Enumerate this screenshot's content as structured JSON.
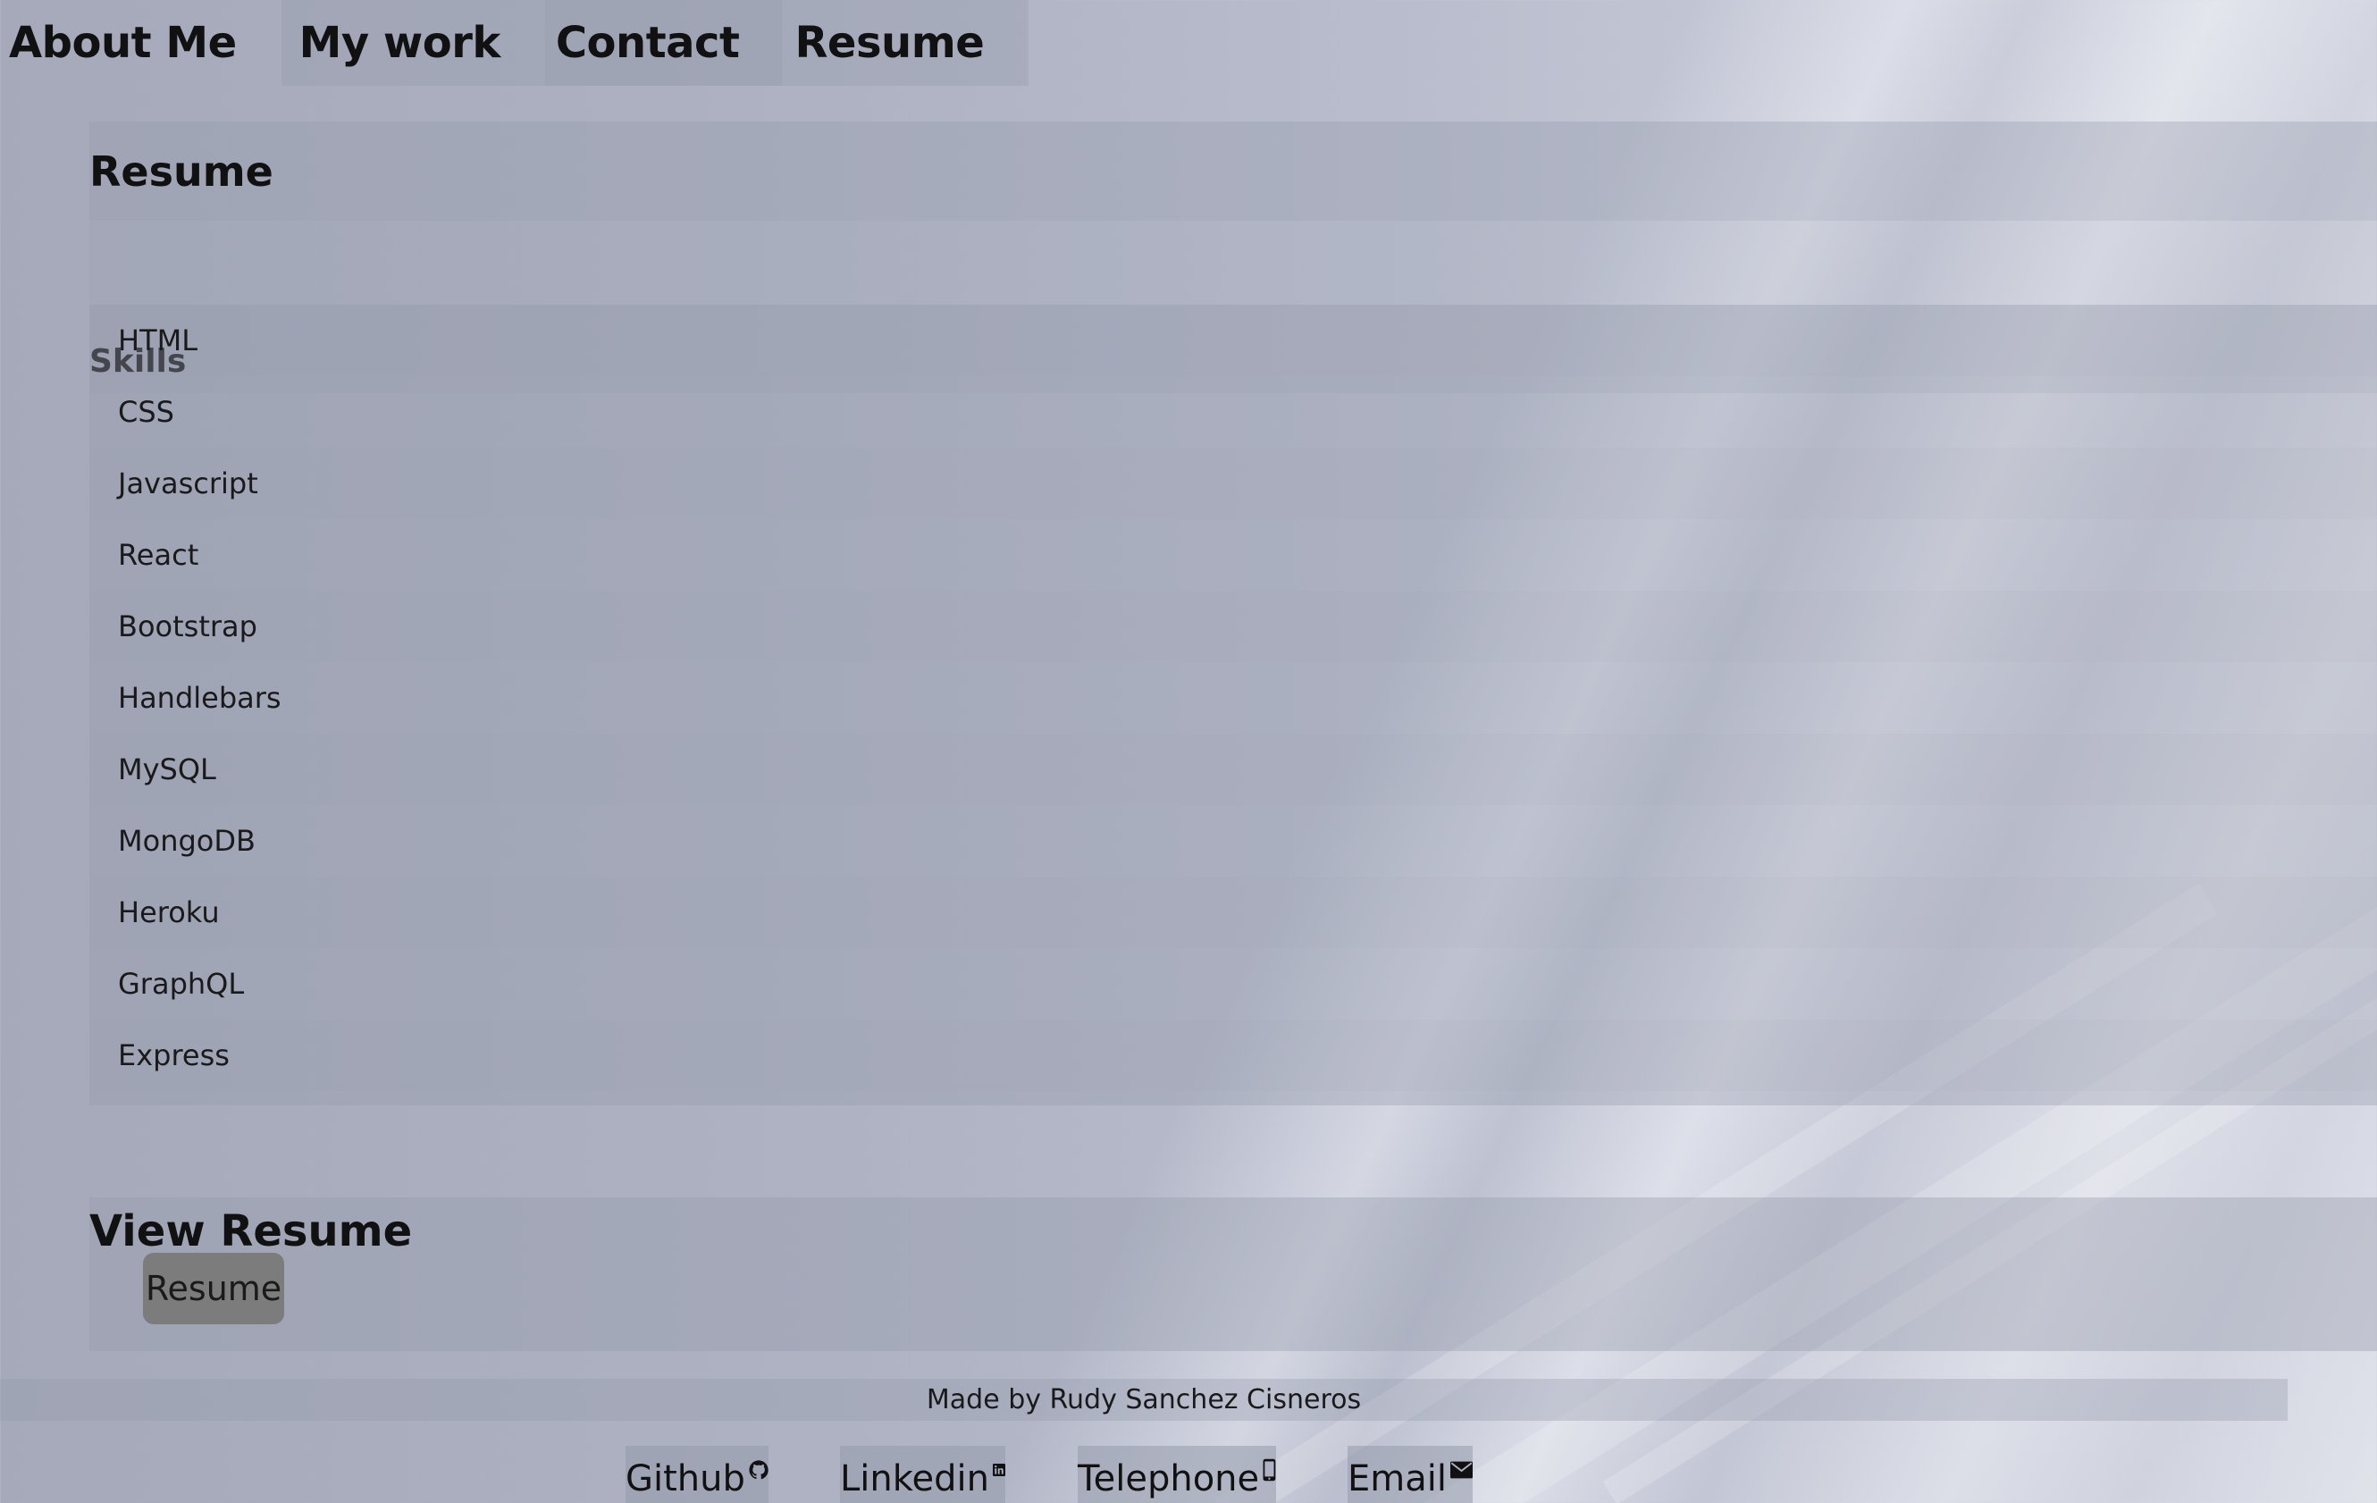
{
  "nav": {
    "about": "About Me",
    "work": "My work",
    "contact": "Contact",
    "resume": "Resume"
  },
  "main": {
    "title": "Resume",
    "skills_heading": "Skills",
    "skills": [
      "HTML",
      "CSS",
      "Javascript",
      "React",
      "Bootstrap",
      "Handlebars",
      "MySQL",
      "MongoDB",
      "Heroku",
      "GraphQL",
      "Express"
    ],
    "view_heading": "View Resume",
    "view_button": "Resume"
  },
  "footer": {
    "credit": "Made by Rudy Sanchez Cisneros",
    "links": {
      "github": "Github",
      "linkedin": "Linkedin",
      "telephone": "Telephone",
      "email": "Email"
    },
    "icons": {
      "github": "github-icon",
      "linkedin": "linkedin-icon",
      "telephone": "phone-icon",
      "email": "envelope-icon"
    }
  },
  "colors": {
    "button_bg": "#7c7c7c",
    "panel_tint": "#969aac"
  }
}
